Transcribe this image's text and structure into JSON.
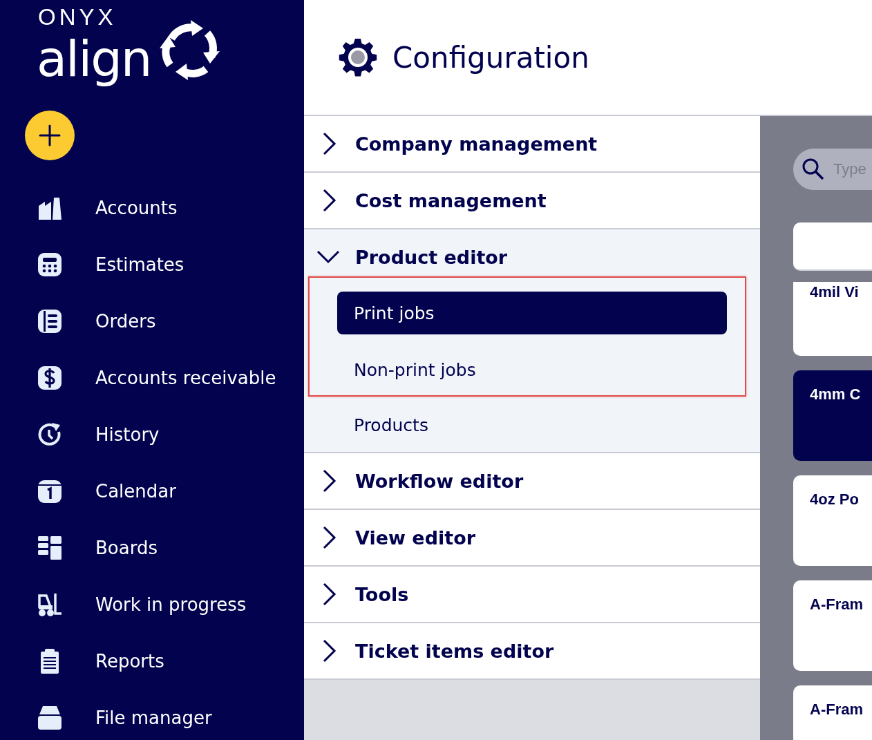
{
  "logo": {
    "brand": "ONYX",
    "product": "align"
  },
  "sidebar": {
    "items": [
      {
        "label": "Accounts"
      },
      {
        "label": "Estimates"
      },
      {
        "label": "Orders"
      },
      {
        "label": "Accounts receivable"
      },
      {
        "label": "History"
      },
      {
        "label": "Calendar"
      },
      {
        "label": "Boards"
      },
      {
        "label": "Work in progress"
      },
      {
        "label": "Reports"
      },
      {
        "label": "File manager"
      }
    ]
  },
  "header": {
    "title": "Configuration"
  },
  "sections": [
    {
      "label": "Company management",
      "expanded": false
    },
    {
      "label": "Cost management",
      "expanded": false
    },
    {
      "label": "Product editor",
      "expanded": true,
      "children": [
        {
          "kind": "frame",
          "children": [
            {
              "kind": "item",
              "label": "Print jobs",
              "selected": true
            },
            {
              "kind": "item",
              "label": "Non-print jobs",
              "selected": false
            }
          ]
        },
        {
          "kind": "item",
          "label": "Products",
          "selected": false
        }
      ]
    },
    {
      "label": "Workflow editor",
      "expanded": false
    },
    {
      "label": "View editor",
      "expanded": false
    },
    {
      "label": "Tools",
      "expanded": false
    },
    {
      "label": "Ticket items editor",
      "expanded": false
    }
  ],
  "search": {
    "placeholder": "Type"
  },
  "cards": [
    {
      "kind": "header",
      "selected": false
    },
    {
      "kind": "partial",
      "title": "4mil Vi",
      "selected": false
    },
    {
      "kind": "item",
      "title": "4mm C",
      "selected": true
    },
    {
      "kind": "item",
      "title": "4oz Po",
      "selected": false
    },
    {
      "kind": "item",
      "title": "A-Fram",
      "selected": false
    },
    {
      "kind": "item",
      "title": "A-Fram",
      "selected": false
    }
  ]
}
